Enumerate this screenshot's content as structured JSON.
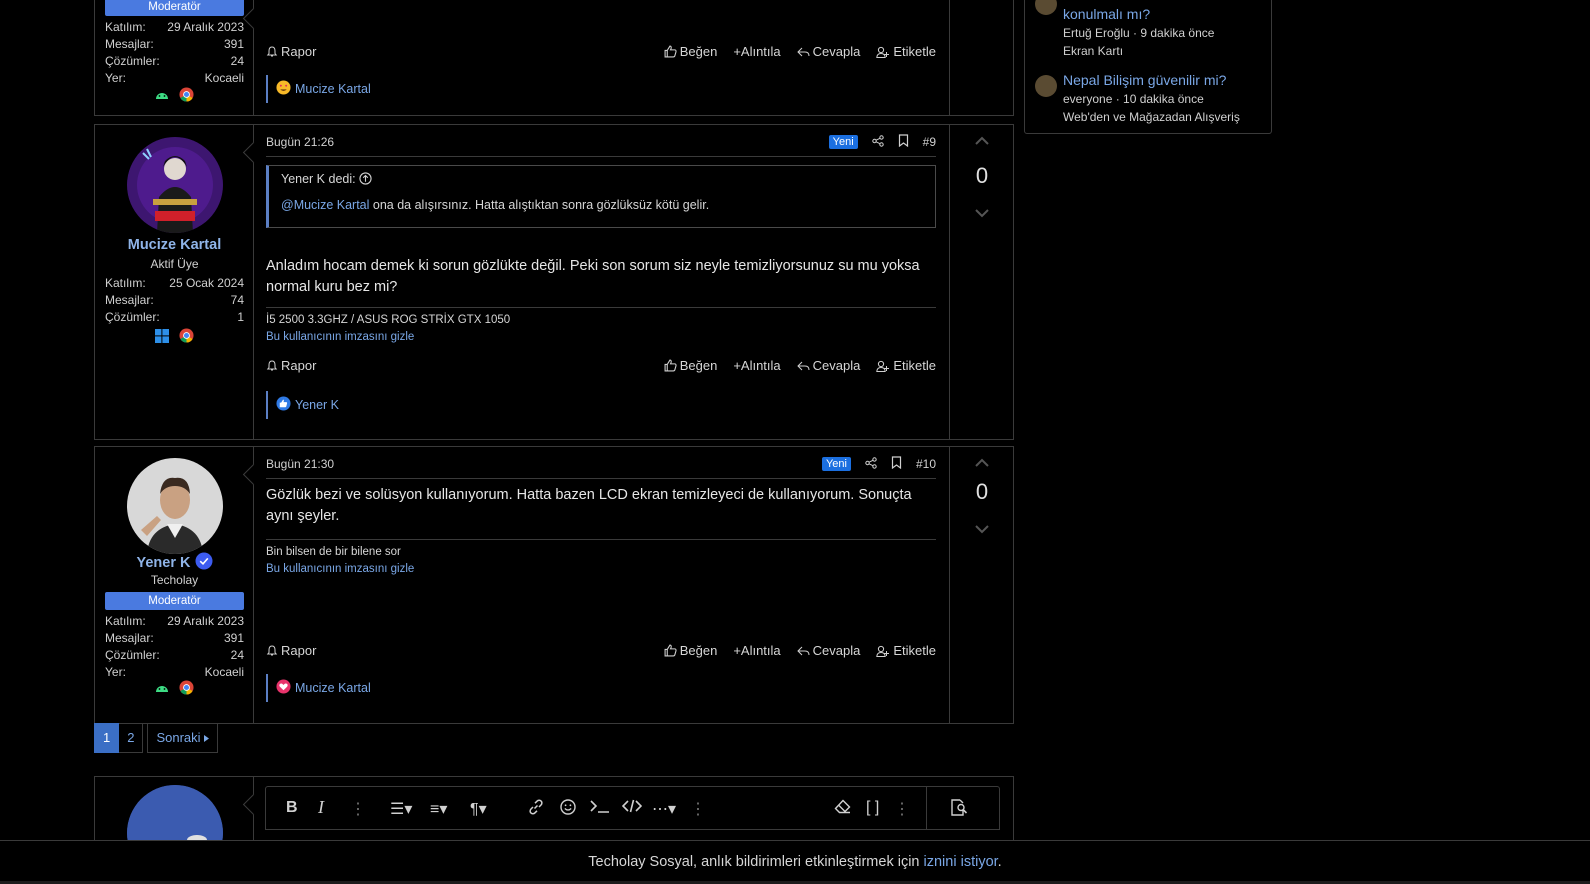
{
  "prev_post": {
    "badge": "Moderatör",
    "stats": [
      {
        "k": "Katılım:",
        "v": "29 Aralık 2023"
      },
      {
        "k": "Mesajlar:",
        "v": "391"
      },
      {
        "k": "Çözümler:",
        "v": "24"
      },
      {
        "k": "Yer:",
        "v": "Kocaeli"
      }
    ],
    "reaction_user": "Mucize Kartal"
  },
  "actions": {
    "report": "Rapor",
    "like": "Beğen",
    "quote": "+Alıntıla",
    "reply": "Cevapla",
    "tag": "Etiketle"
  },
  "post9": {
    "username": "Mucize Kartal",
    "user_title": "Aktif Üye",
    "stats": [
      {
        "k": "Katılım:",
        "v": "25 Ocak 2024"
      },
      {
        "k": "Mesajlar:",
        "v": "74"
      },
      {
        "k": "Çözümler:",
        "v": "1"
      }
    ],
    "date": "Bugün 21:26",
    "new_label": "Yeni",
    "number": "#9",
    "quote_header": "Yener K dedi:",
    "quote_mention": "@Mucize Kartal",
    "quote_text": " ona da alışırsınız. Hatta alıştıktan sonra gözlüksüz kötü gelir.",
    "message": "Anladım hocam demek ki sorun gözlükte değil. Peki son sorum siz neyle temizliyorsunuz su mu yoksa normal kuru bez mi?",
    "signature": "İ5 2500 3.3GHZ / ASUS ROG STRİX GTX 1050",
    "hide_signature": "Bu kullanıcının imzasını gizle",
    "reaction_user": "Yener K",
    "votes": "0"
  },
  "post10": {
    "username": "Yener K",
    "user_title": "Techolay",
    "badge": "Moderatör",
    "stats": [
      {
        "k": "Katılım:",
        "v": "29 Aralık 2023"
      },
      {
        "k": "Mesajlar:",
        "v": "391"
      },
      {
        "k": "Çözümler:",
        "v": "24"
      },
      {
        "k": "Yer:",
        "v": "Kocaeli"
      }
    ],
    "date": "Bugün 21:30",
    "new_label": "Yeni",
    "number": "#10",
    "message": "Gözlük bezi ve solüsyon kullanıyorum. Hatta bazen LCD ekran temizleyeci de kullanıyorum. Sonuçta aynı şeyler.",
    "signature": "Bin bilsen de bir bilene sor",
    "hide_signature": "Bu kullanıcının imzasını gizle",
    "reaction_user": "Mucize Kartal",
    "votes": "0"
  },
  "sidebar": {
    "items": [
      {
        "title": "konulmalı mı?",
        "meta": "Ertuğ Eroğlu · 9 dakika önce",
        "forum": "Ekran Kartı"
      },
      {
        "title": "Nepal Bilişim güvenilir mi?",
        "meta": "everyone · 10 dakika önce",
        "forum": "Web'den ve Mağazadan Alışveriş"
      }
    ]
  },
  "pagination": {
    "pages": [
      "1",
      "2"
    ],
    "next": "Sonraki"
  },
  "notice": {
    "before": "Techolay Sosyal, anlık bildirimleri etkinleştirmek için ",
    "link1": "iznini",
    "mid": " ",
    "link2": "istiyor",
    "after": "."
  },
  "colors": {
    "accent": "#7aa7e6",
    "badge": "#4a7ae0",
    "new": "#1b6fe0",
    "border": "#3a3a3a"
  }
}
